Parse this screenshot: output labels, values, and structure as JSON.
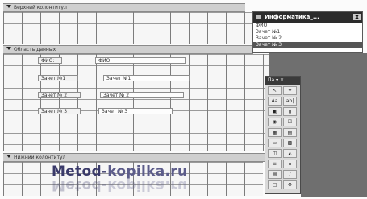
{
  "sections": {
    "header": "Верхний колонтитул",
    "detail": "Область данных",
    "footer": "Нижний колонтитул"
  },
  "controls": [
    {
      "label": "ФИО:",
      "field": "ФИО"
    },
    {
      "label": "Зачет №1",
      "field": "Зачет №1"
    },
    {
      "label": "Зачет № 2",
      "field": "Зачет № 2"
    },
    {
      "label": "Зачет № 3",
      "field": "Зачет № 3"
    }
  ],
  "field_list": {
    "title": "Информатика_...",
    "close": "x",
    "items": [
      "ФИО",
      "Зачет №1",
      "Зачет № 2",
      "Зачет № 3"
    ],
    "selected_index": 3
  },
  "toolbox": {
    "title": "Па ▾ ×",
    "tools": [
      "pointer-tool",
      "wizard-tool",
      "label-tool",
      "textbox-tool",
      "option-group-tool",
      "toggle-tool",
      "option-button-tool",
      "checkbox-tool",
      "combo-box-tool",
      "list-box-tool",
      "command-button-tool",
      "image-tool",
      "unbound-frame-tool",
      "bound-frame-tool",
      "page-break-tool",
      "tab-control-tool",
      "subform-tool",
      "line-tool",
      "rectangle-tool",
      "more-tools-tool"
    ]
  },
  "watermark": {
    "part1": "Metod-",
    "part2": "kopilka.ru"
  }
}
